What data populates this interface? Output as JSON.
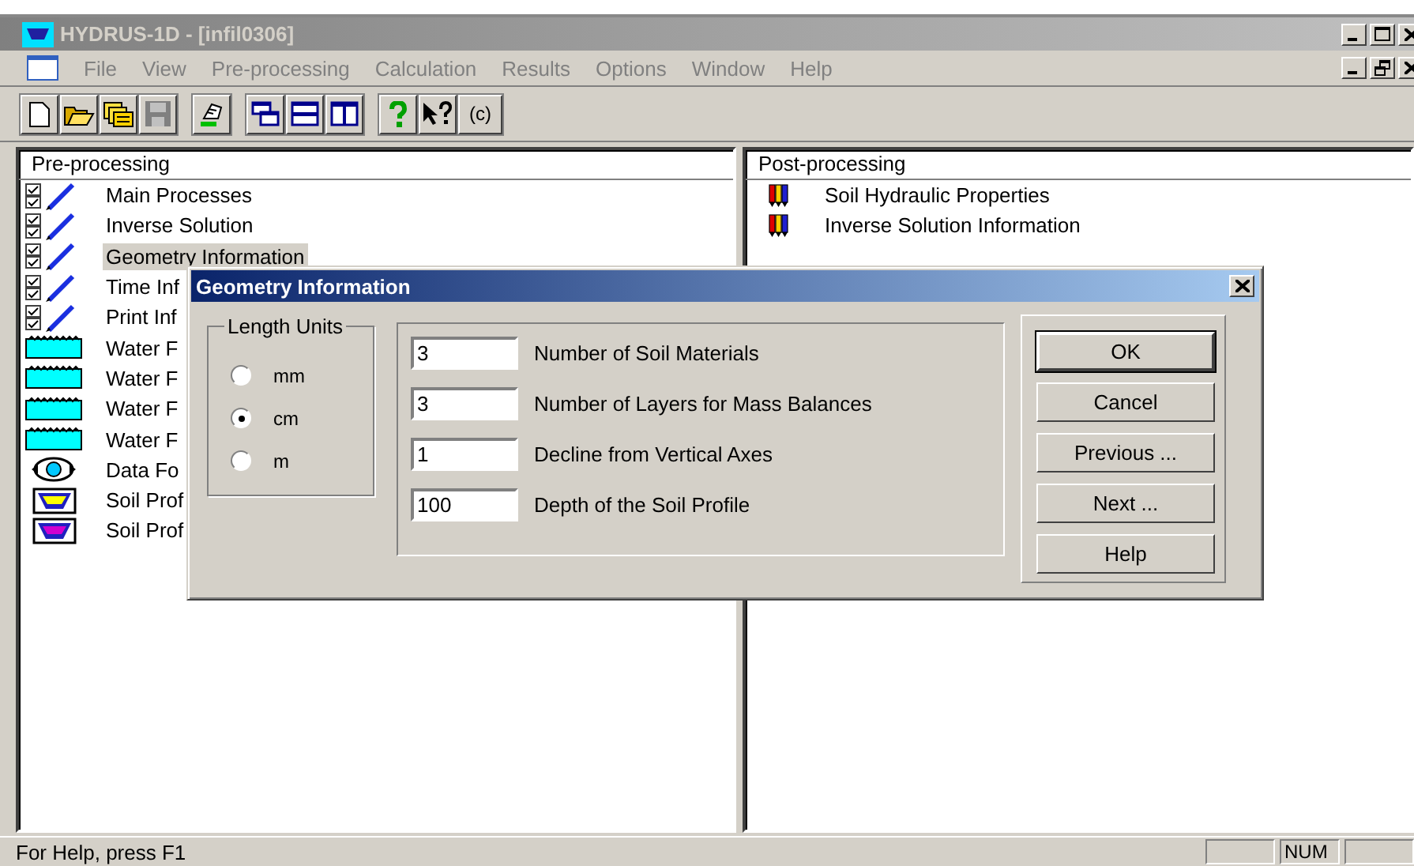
{
  "window": {
    "title": "HYDRUS-1D - [infil0306]"
  },
  "menu": [
    "File",
    "View",
    "Pre-processing",
    "Calculation",
    "Results",
    "Options",
    "Window",
    "Help"
  ],
  "toolbar": {
    "about_label": "(c)"
  },
  "pre_processing": {
    "title": "Pre-processing",
    "items": [
      {
        "label": "Main Processes",
        "kind": "pen",
        "selected": false
      },
      {
        "label": "Inverse Solution",
        "kind": "pen",
        "selected": false
      },
      {
        "label": "Geometry Information",
        "kind": "pen",
        "selected": true
      },
      {
        "label": "Time Inf",
        "kind": "pen",
        "selected": false
      },
      {
        "label": "Print Inf",
        "kind": "pen",
        "selected": false
      },
      {
        "label": "Water F",
        "kind": "water",
        "selected": false
      },
      {
        "label": "Water F",
        "kind": "water",
        "selected": false
      },
      {
        "label": "Water F",
        "kind": "water",
        "selected": false
      },
      {
        "label": "Water F",
        "kind": "water",
        "selected": false
      },
      {
        "label": "Data Fo",
        "kind": "data",
        "selected": false
      },
      {
        "label": "Soil Prof",
        "kind": "soil",
        "selected": false
      },
      {
        "label": "Soil Prof",
        "kind": "soil",
        "selected": false
      }
    ]
  },
  "post_processing": {
    "title": "Post-processing",
    "items": [
      {
        "label": "Soil Hydraulic Properties"
      },
      {
        "label": "Inverse Solution Information"
      }
    ]
  },
  "dialog": {
    "title": "Geometry Information",
    "length_units": {
      "title": "Length Units",
      "options": [
        {
          "label": "mm",
          "selected": false
        },
        {
          "label": "cm",
          "selected": true
        },
        {
          "label": "m",
          "selected": false
        }
      ]
    },
    "fields": [
      {
        "value": "3",
        "label": "Number of Soil Materials"
      },
      {
        "value": "3",
        "label": "Number of Layers for Mass Balances"
      },
      {
        "value": "1",
        "label": "Decline from Vertical Axes"
      },
      {
        "value": "100",
        "label": "Depth of the Soil Profile"
      }
    ],
    "buttons": [
      {
        "label": "OK",
        "default": true
      },
      {
        "label": "Cancel",
        "default": false
      },
      {
        "label": "Previous ...",
        "default": false
      },
      {
        "label": "Next ...",
        "default": false
      },
      {
        "label": "Help",
        "default": false
      }
    ]
  },
  "status_bar": {
    "text": "For Help, press F1",
    "indicators": [
      "NUM"
    ]
  }
}
